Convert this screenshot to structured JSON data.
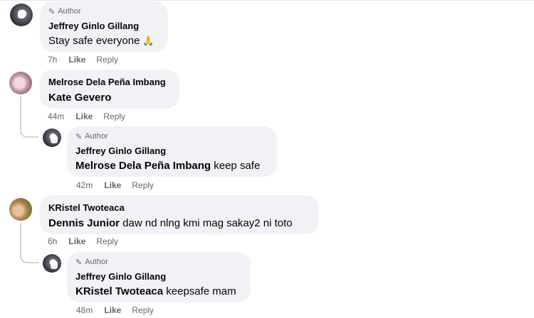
{
  "comments": [
    {
      "author_badge": "Author",
      "name": "Jeffrey Ginlo Gillang",
      "text": "Stay safe everyone",
      "emoji": "🙏",
      "time": "7h",
      "like": "Like",
      "reply": "Reply"
    },
    {
      "name": "Melrose Dela Peña Imbang",
      "mention": "Kate Gevero",
      "text": "",
      "time": "44m",
      "like": "Like",
      "reply": "Reply"
    },
    {
      "author_badge": "Author",
      "name": "Jeffrey Ginlo Gillang",
      "mention": "Melrose Dela Peña Imbang",
      "text": " keep safe",
      "time": "42m",
      "like": "Like",
      "reply": "Reply"
    },
    {
      "name": "KRistel Twoteaca",
      "mention": "Dennis Junior",
      "text": " daw nd nlng kmi mag sakay2 ni toto",
      "time": "6h",
      "like": "Like",
      "reply": "Reply"
    },
    {
      "author_badge": "Author",
      "name": "Jeffrey Ginlo Gillang",
      "mention": "KRistel Twoteaca",
      "text": " keepsafe mam",
      "time": "48m",
      "like": "Like",
      "reply": "Reply"
    }
  ],
  "icons": {
    "author_badge_icon": "pencil-icon",
    "emoji_icon": "folded-hands-icon"
  },
  "colors": {
    "bubble_bg": "#f0f2f5",
    "secondary_text": "#65676b",
    "primary_text": "#050505"
  }
}
